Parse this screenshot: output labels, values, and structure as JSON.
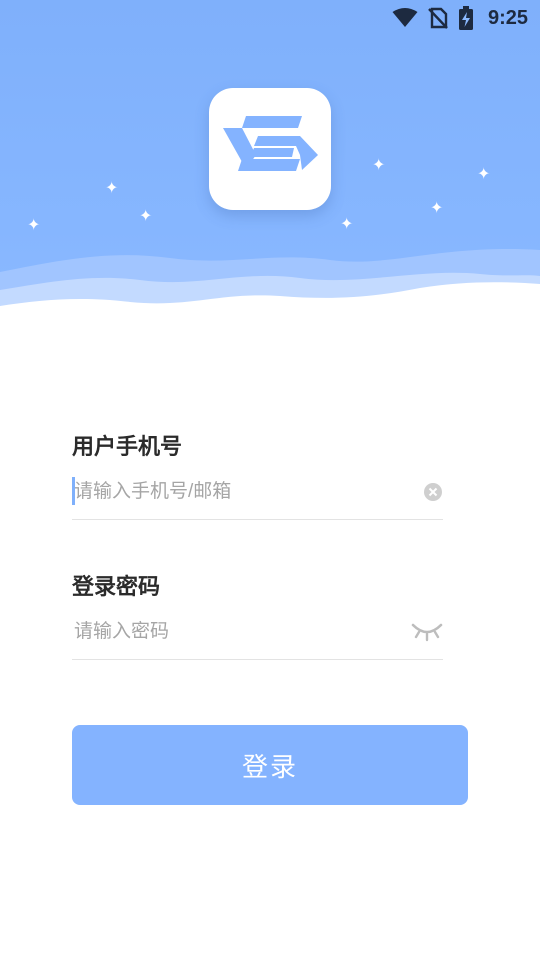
{
  "status_bar": {
    "time": "9:25",
    "icons": [
      "wifi-icon",
      "no-sim-icon",
      "battery-charging-icon"
    ]
  },
  "logo": {
    "icon": "app-logo-icon",
    "color": "#84b3ff"
  },
  "form": {
    "username": {
      "label": "用户手机号",
      "placeholder": "请输入手机号/邮箱",
      "value": "",
      "clear_icon": "clear-circle-icon"
    },
    "password": {
      "label": "登录密码",
      "placeholder": "请输入密码",
      "value": "",
      "toggle_icon": "eye-closed-icon"
    }
  },
  "login_button": {
    "label": "登录"
  },
  "colors": {
    "accent": "#84b3ff",
    "header": "#7fb0fb",
    "label_text": "#2b2b2b",
    "placeholder": "#a5a5a5"
  }
}
